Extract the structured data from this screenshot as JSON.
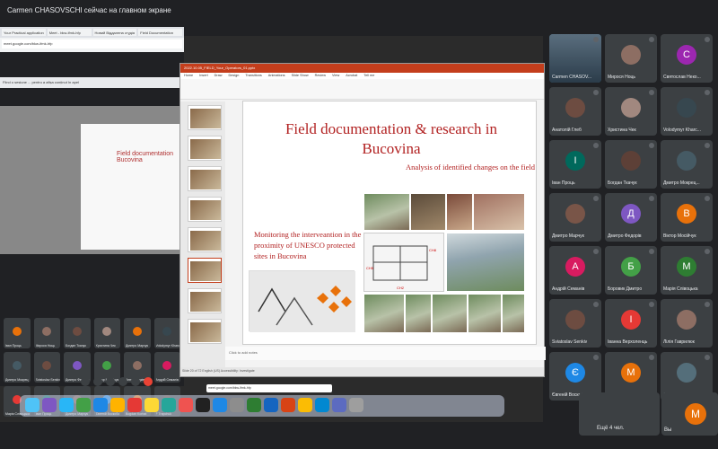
{
  "meet": {
    "presenting_banner": "Carmen CHASOVSCHI сейчас на главном экране",
    "more_label": "Ещё 4 чел.",
    "you_label": "Вы",
    "you_initial": "M"
  },
  "browser": {
    "tabs": [
      "Your Practical application",
      "Meet - bkw-ifmk-hfp",
      "Новий Віддалена студія",
      "Field Documentation"
    ],
    "url": "meet.google.com/bkw-ifmk-hfp",
    "notice": "Fiind o sesiune ... pentru a afișa conținut în apel",
    "mini_slide_title": "Field documentation Bucovina"
  },
  "ppt": {
    "window_title": "2022.10.05_FIELD_Your_Operators_01.pptx",
    "menus": [
      "Home",
      "Insert",
      "Draw",
      "Design",
      "Transitions",
      "Animations",
      "Slide Show",
      "Review",
      "View",
      "Acrobat",
      "Tell me"
    ],
    "notes_placeholder": "Click to add notes",
    "status": "Slide 20 of 72   English (US)   Accessibility: Investigate"
  },
  "slide": {
    "title": "Field documentation & research in Bucovina",
    "subtitle": "Analysis of identified changes on the field",
    "left_text": "Monitoring the interveantion in the proximity of UNESCO protected sites in Bucovina"
  },
  "participants": [
    {
      "name": "Carmen CHASOV...",
      "initial": "",
      "color": "#2a6e8e",
      "speaker": true
    },
    {
      "name": "Мирося Ноць",
      "initial": "",
      "color": "#8d6e63",
      "speaker": false
    },
    {
      "name": "Святослав Неко...",
      "initial": "С",
      "color": "#9c27b0",
      "speaker": false
    },
    {
      "name": "Анатолій Глеб",
      "initial": "",
      "color": "#6d4c41",
      "speaker": false
    },
    {
      "name": "Христина Чек",
      "initial": "",
      "color": "#a1887f",
      "speaker": false
    },
    {
      "name": "Volodymyr Kharc...",
      "initial": "",
      "color": "#37474f",
      "speaker": false
    },
    {
      "name": "Іван Проць",
      "initial": "І",
      "color": "#00695c",
      "speaker": false
    },
    {
      "name": "Богдан Ткачук",
      "initial": "",
      "color": "#5d4037",
      "speaker": false
    },
    {
      "name": "Дмитро Мокрец...",
      "initial": "",
      "color": "#455a64",
      "speaker": false
    },
    {
      "name": "Дмитро Марчук",
      "initial": "",
      "color": "#795548",
      "speaker": false
    },
    {
      "name": "Дмитро Федорів",
      "initial": "Д",
      "color": "#7e57c2",
      "speaker": false
    },
    {
      "name": "Віктор Мосійчук",
      "initial": "В",
      "color": "#e8710a",
      "speaker": false
    },
    {
      "name": "Андрій Семанів",
      "initial": "А",
      "color": "#d81b60",
      "speaker": false
    },
    {
      "name": "Боровик Дмитро",
      "initial": "Б",
      "color": "#43a047",
      "speaker": false
    },
    {
      "name": "Марія Слівоцька",
      "initial": "М",
      "color": "#2e7d32",
      "speaker": false
    },
    {
      "name": "Sviatoslav Senkiv",
      "initial": "",
      "color": "#6d4c41",
      "speaker": false
    },
    {
      "name": "Іванна Верхоленць",
      "initial": "І",
      "color": "#e53935",
      "speaker": false
    },
    {
      "name": "Лілія Гаврилюк",
      "initial": "",
      "color": "#8d6e63",
      "speaker": false
    },
    {
      "name": "Євгеній Воскобо...",
      "initial": "Є",
      "color": "#1e88e5",
      "speaker": false
    },
    {
      "name": "Марʼян Тріщ",
      "initial": "М",
      "color": "#e8710a",
      "speaker": false
    },
    {
      "name": "Єрмаков Максим Г...",
      "initial": "",
      "color": "#546e7a",
      "speaker": false
    }
  ],
  "mini_participants": [
    {
      "name": "Іван Проць",
      "color": "#e8710a"
    },
    {
      "name": "Мирося Ноць",
      "color": "#8d6e63"
    },
    {
      "name": "Богдан Ткачук",
      "color": "#6d4c41"
    },
    {
      "name": "Христина Чек",
      "color": "#a1887f"
    },
    {
      "name": "Дмитро Марчук",
      "color": "#e8710a"
    },
    {
      "name": "Volodymyr Kharc",
      "color": "#37474f"
    },
    {
      "name": "Дмитро Мокрец",
      "color": "#455a64"
    },
    {
      "name": "Sviatoslav Senkiv",
      "color": "#6d4c41"
    },
    {
      "name": "Дмитро Федорів",
      "color": "#7e57c2"
    },
    {
      "name": "Віктор Мосійчук",
      "color": "#43a047"
    },
    {
      "name": "Анна Гладків",
      "color": "#8d6e63"
    },
    {
      "name": "Андрій Семанів",
      "color": "#d81b60"
    },
    {
      "name": "Марія Слівоцька",
      "color": "#e53935"
    },
    {
      "name": "Іван Проць",
      "color": "#00695c"
    },
    {
      "name": "Дмитро Марчук",
      "color": "#795548"
    },
    {
      "name": "Євгеній Воскобо",
      "color": "#1e88e5"
    },
    {
      "name": "Bogdan Korbat",
      "color": "#e8710a"
    },
    {
      "name": "F Trapchuk",
      "color": "#5d4037"
    }
  ]
}
